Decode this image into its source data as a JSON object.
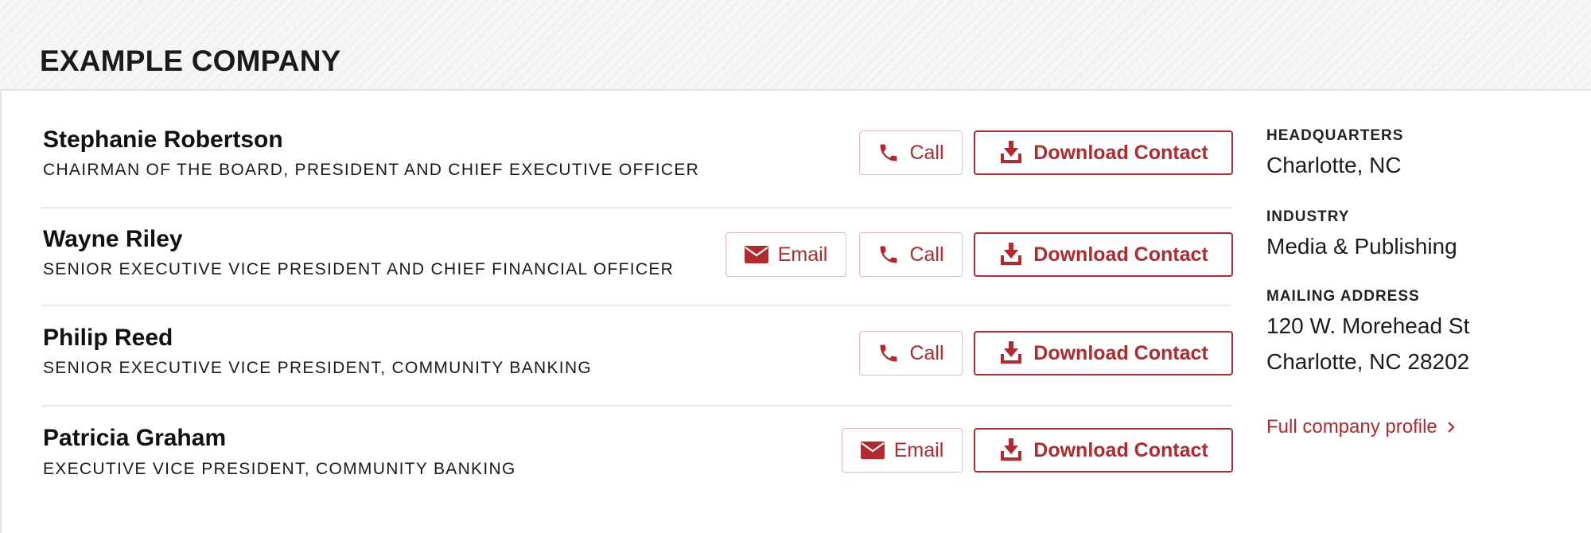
{
  "company": {
    "name": "EXAMPLE COMPANY"
  },
  "contacts": [
    {
      "name": "Stephanie Robertson",
      "title": "CHAIRMAN OF THE BOARD, PRESIDENT AND CHIEF EXECUTIVE OFFICER",
      "actions": [
        "call",
        "download"
      ]
    },
    {
      "name": "Wayne Riley",
      "title": "SENIOR EXECUTIVE VICE PRESIDENT AND CHIEF FINANCIAL OFFICER",
      "actions": [
        "email",
        "call",
        "download"
      ]
    },
    {
      "name": "Philip Reed",
      "title": "SENIOR EXECUTIVE VICE PRESIDENT, COMMUNITY BANKING",
      "actions": [
        "call",
        "download"
      ]
    },
    {
      "name": "Patricia Graham",
      "title": "EXECUTIVE VICE PRESIDENT, COMMUNITY BANKING",
      "actions": [
        "email",
        "download"
      ]
    }
  ],
  "buttons": {
    "call_label": "Call",
    "email_label": "Email",
    "download_label": "Download Contact"
  },
  "sidebar": {
    "headquarters_label": "HEADQUARTERS",
    "headquarters_value": "Charlotte, NC",
    "industry_label": "INDUSTRY",
    "industry_value": "Media & Publishing",
    "mailing_label": "MAILING ADDRESS",
    "mailing_line1": "120 W. Morehead St",
    "mailing_line2": "Charlotte, NC 28202",
    "profile_link": "Full company profile"
  },
  "colors": {
    "accent": "#b32a2e",
    "text": "#111111",
    "divider": "#e8e8e8",
    "header_band": "#f6f6f6"
  },
  "icons": {
    "call": "phone-icon",
    "email": "envelope-icon",
    "download": "download-icon",
    "link": "chevron-right-icon"
  }
}
